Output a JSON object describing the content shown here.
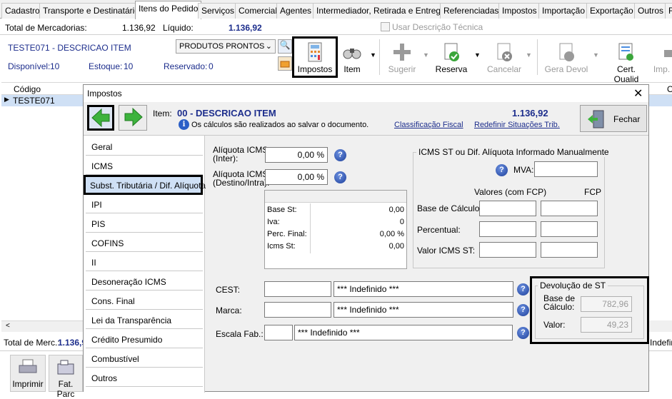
{
  "tabs": [
    "Cadastro",
    "Transporte e Destinatário",
    "Itens do Pedido",
    "Serviços",
    "Comercial",
    "Agentes",
    "Intermediador, Retirada e Entrega",
    "Referenciadas",
    "Impostos",
    "Importação",
    "Exportação",
    "Outros"
  ],
  "totals": {
    "merc_label": "Total de Mercadorias:",
    "merc_value": "1.136,92",
    "liq_label": "Líquido:",
    "liq_value": "1.136,92",
    "desc_tecnica": "Usar Descrição Técnica"
  },
  "product": {
    "name": "TESTE071 - DESCRICAO ITEM",
    "category": "PRODUTOS PRONTOS",
    "disponivel_label": "Disponível:",
    "disponivel": "10",
    "estoque_label": "Estoque:",
    "estoque": "10",
    "reservado_label": "Reservado:",
    "reservado": "0"
  },
  "toolbar": {
    "impostos": "Impostos",
    "item": "Item",
    "sugerir": "Sugerir",
    "reserva": "Reserva",
    "cancelar": "Cancelar",
    "gera_devol": "Gera Devol",
    "cert_qualid": "Cert. Qualid",
    "imp": "Imp."
  },
  "grid": {
    "col_codigo": "Código",
    "row_code": "TESTE071",
    "col_right": "O"
  },
  "bottom": {
    "total_merc_label": "Total de Merc.:",
    "total_merc_value": "1.136,9",
    "indef": "Indefin",
    "imprimir": "Imprimir",
    "fat_parc": "Fat. Parc"
  },
  "dialog": {
    "title": "Impostos",
    "item_label": "Item:",
    "item_name": "00 - DESCRICAO ITEM",
    "item_value": "1.136,92",
    "info": "Os cálculos são realizados ao salvar o documento.",
    "link_class": "Classificação Fiscal",
    "link_redef": "Redefinir Situações Trib.",
    "fechar": "Fechar",
    "side_items": [
      "Geral",
      "ICMS",
      "Subst. Tributária / Dif. Alíquota",
      "IPI",
      "PIS",
      "COFINS",
      "II",
      "Desoneração ICMS",
      "Cons. Final",
      "Lei da Transparência",
      "Crédito Presumido",
      "Combustível",
      "Outros"
    ],
    "aliq_inter_label": "Alíquota ICMS (Inter):",
    "aliq_inter": "0,00 %",
    "aliq_dest_label": "Alíquota ICMS (Destino/Intra):",
    "aliq_dest": "0,00 %",
    "st_table": [
      {
        "label": "Base St:",
        "value": "0,00"
      },
      {
        "label": "Iva:",
        "value": "0"
      },
      {
        "label": "Perc. Final:",
        "value": "0,00 %"
      },
      {
        "label": "Icms St:",
        "value": "0,00"
      }
    ],
    "manual_title": "ICMS ST ou Dif. Alíquota Informado Manualmente",
    "mva_label": "MVA:",
    "valores_label": "Valores (com FCP)",
    "fcp_label": "FCP",
    "base_calc_label": "Base de Cálculo:",
    "percentual_label": "Percentual:",
    "valor_icms_st_label": "Valor ICMS ST:",
    "cest_label": "CEST:",
    "cest_value": "*** Indefinido ***",
    "marca_label": "Marca:",
    "marca_value": "*** Indefinido ***",
    "escala_label": "Escala Fab.:",
    "escala_value": "*** Indefinido ***",
    "devol_title": "Devolução de  ST",
    "devol_base_label": "Base de Cálculo:",
    "devol_base": "782,96",
    "devol_valor_label": "Valor:",
    "devol_valor": "49,23"
  },
  "colors": {
    "accent_blue": "#1c2d8c",
    "selection": "#cfe0f5",
    "arrow_green": "#3db33d"
  }
}
